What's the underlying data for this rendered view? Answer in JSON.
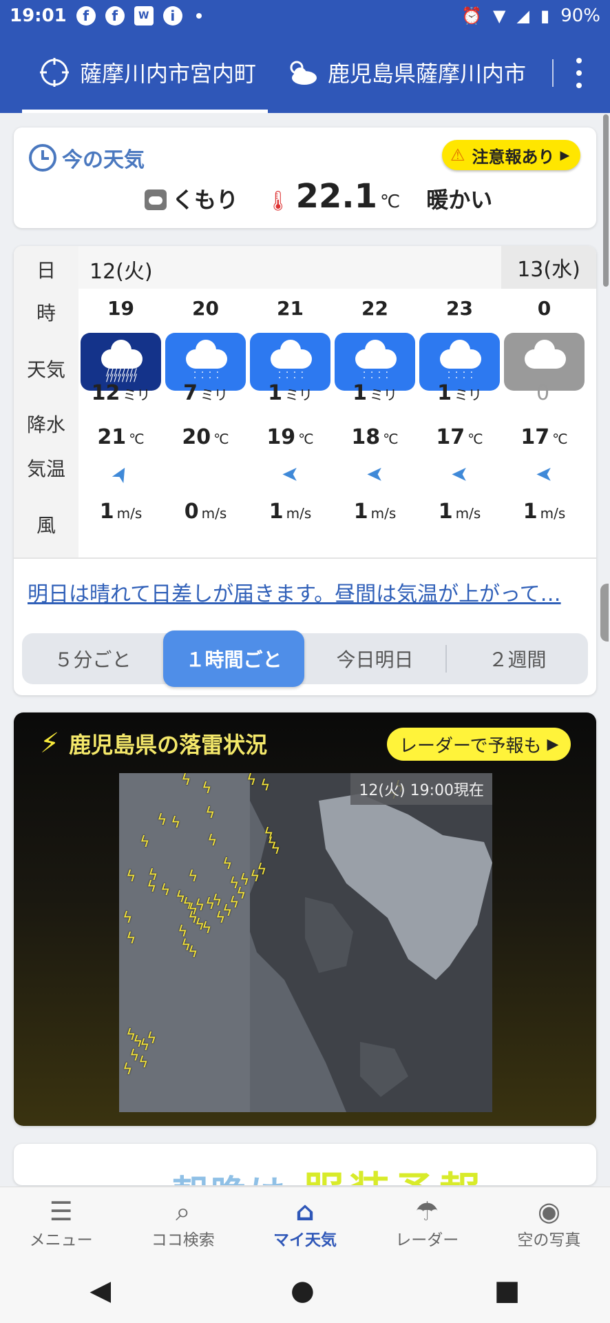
{
  "status_bar": {
    "time": "19:01",
    "battery": "90%",
    "icons": [
      "facebook-icon",
      "facebook-icon",
      "weathernews-icon",
      "info-icon",
      "alarm-icon",
      "wifi-icon",
      "signal-icon",
      "battery-icon"
    ]
  },
  "header": {
    "location_current": "薩摩川内市宮内町",
    "location_saved": "鹿児島県薩摩川内市"
  },
  "now": {
    "title": "今の天気",
    "alert": "注意報あり",
    "condition": "くもり",
    "temperature": "22.1",
    "unit": "℃",
    "feel": "暖かい"
  },
  "forecast": {
    "row_labels": {
      "day": "日",
      "hour": "時",
      "weather": "天気",
      "precip": "降水",
      "temp": "気温",
      "wind": "風"
    },
    "day1": "12(火)",
    "day2": "13(水)",
    "hours": [
      {
        "hour": "19",
        "weather": "heavy-rain",
        "precip": "12",
        "precip_unit": "ミリ",
        "temp": "21",
        "temp_unit": "℃",
        "wind_dir": "➤",
        "wind": "1",
        "wind_unit": "m/s"
      },
      {
        "hour": "20",
        "weather": "rain",
        "precip": "7",
        "precip_unit": "ミリ",
        "temp": "20",
        "temp_unit": "℃",
        "wind_dir": "",
        "wind": "0",
        "wind_unit": "m/s"
      },
      {
        "hour": "21",
        "weather": "rain",
        "precip": "1",
        "precip_unit": "ミリ",
        "temp": "19",
        "temp_unit": "℃",
        "wind_dir": "➤",
        "wind": "1",
        "wind_unit": "m/s"
      },
      {
        "hour": "22",
        "weather": "rain",
        "precip": "1",
        "precip_unit": "ミリ",
        "temp": "18",
        "temp_unit": "℃",
        "wind_dir": "➤",
        "wind": "1",
        "wind_unit": "m/s"
      },
      {
        "hour": "23",
        "weather": "rain",
        "precip": "1",
        "precip_unit": "ミリ",
        "temp": "17",
        "temp_unit": "℃",
        "wind_dir": "➤",
        "wind": "1",
        "wind_unit": "m/s"
      },
      {
        "hour": "0",
        "weather": "cloudy",
        "precip": "0",
        "precip_unit": "",
        "temp": "17",
        "temp_unit": "℃",
        "wind_dir": "➤",
        "wind": "1",
        "wind_unit": "m/s"
      }
    ],
    "summary": "明日は晴れて日差しが届きます。昼間は気温が上がって…",
    "tabs": [
      "５分ごと",
      "１時間ごと",
      "今日明日",
      "２週間"
    ],
    "active_tab": 1
  },
  "thunder": {
    "title": "鹿児島県の落雷状況",
    "radar_button": "レーダーで予報も",
    "map_time": "12(火) 19:00現在"
  },
  "banner": {
    "text1": "朝晩は",
    "text2": "服装予報"
  },
  "bottom_nav": [
    {
      "label": "メニュー",
      "icon": "menu-icon"
    },
    {
      "label": "ココ検索",
      "icon": "search-icon"
    },
    {
      "label": "マイ天気",
      "icon": "home-icon"
    },
    {
      "label": "レーダー",
      "icon": "radar-umbrella-icon"
    },
    {
      "label": "空の写真",
      "icon": "camera-icon"
    }
  ],
  "colors": {
    "brand": "#2f57b8",
    "rain": "#2d79f0",
    "heavy_rain": "#14338a",
    "cloudy": "#9a9a9a",
    "alert": "#ffe600",
    "lightning": "#f5e43a"
  }
}
